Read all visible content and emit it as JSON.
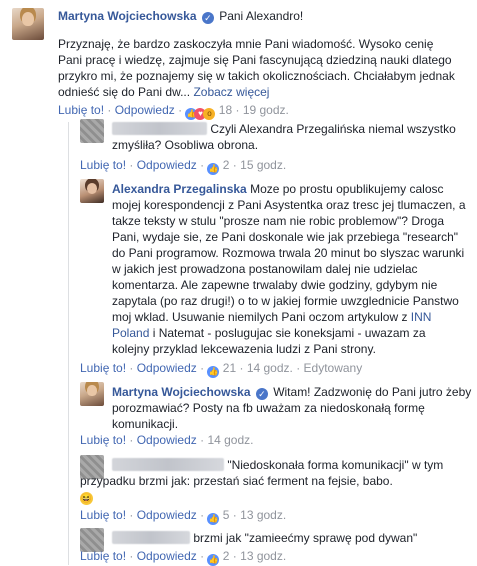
{
  "post": {
    "author": "Martyna Wojciechowska",
    "verified_mark": "✓",
    "title_text": "Pani Alexandro!",
    "line1": "Przyznaję, że bardzo zaskoczyła mnie Pani wiadomość. Wysoko cenię",
    "line2": "Pani pracę i wiedzę, zajmuje się Pani fascynującą dziedziną nauki dlatego",
    "line3": "przykro mi, że poznajemy się w takich okolicznościach. Chciałabym jednak",
    "line4": "odnieść się do Pani dw...",
    "see_more": "Zobacz więcej",
    "like": "Lubię to!",
    "reply": "Odpowiedz",
    "reaction_count": "18",
    "time": "19 godz."
  },
  "comments": [
    {
      "id": "c1",
      "author_hidden": true,
      "line1": "Czyli Alexandra Przegalińska niemal wszystko",
      "line2": "zmyśliła? Osobliwa obrona.",
      "like": "Lubię to!",
      "reply": "Odpowiedz",
      "reaction_count": "2",
      "time": "15 godz."
    },
    {
      "id": "c2",
      "author": "Alexandra Przegalinska",
      "line1": "Moze po prostu opublikujemy calosc",
      "line2": "mojej korespondencji z Pani Asystentka oraz tresc jej tlumaczen, a",
      "line3": "takze teksty w stulu \"prosze nam nie robic problemow\"? Droga",
      "line4": "Pani, wydaje sie, ze Pani doskonale wie jak przebiega \"research\"",
      "line5": "do Pani programow. Rozmowa trwala 20 minut bo slyszac warunki",
      "line6": "w jakich jest prowadzona postanowilam dalej nie udzielac",
      "line7": "komentarza. Ale zapewne trwalaby dwie godziny, gdybym nie",
      "line8": "zapytala (po raz drugi!) o to w jakiej formie uwzglednicie Panstwo",
      "line9": "moj wklad. Usuwanie niemilych Pani oczom artykulow z",
      "link_inn": "INN",
      "link_poland": "Poland",
      "line10": "i Natemat - poslugujac sie koneksjami - uwazam za",
      "line11": "kolejny przyklad lekcewazenia ludzi z Pani strony.",
      "like": "Lubię to!",
      "reply": "Odpowiedz",
      "reaction_count": "21",
      "time": "14 godz.",
      "edited": "Edytowany"
    },
    {
      "id": "c3",
      "author": "Martyna Wojciechowska",
      "line1": "Witam! Zadzwonię do Pani jutro żeby",
      "line2": "porozmawiać? Posty na fb uważam za niedoskonałą formę",
      "line3": "komunikacji.",
      "like": "Lubię to!",
      "reply": "Odpowiedz",
      "time": "14 godz."
    },
    {
      "id": "c4",
      "author_hidden": true,
      "line1": "\"Niedoskonała forma komunikacji\" w tym",
      "line2": "przypadku brzmi jak: przestań siać ferment na fejsie, babo.",
      "emoji": "😆",
      "like": "Lubię to!",
      "reply": "Odpowiedz",
      "reaction_count": "5",
      "time": "13 godz."
    },
    {
      "id": "c5",
      "author_hidden": true,
      "line1": "brzmi jak \"zamieećmy sprawę pod dywan\"",
      "like": "Lubię to!",
      "reply": "Odpowiedz",
      "reaction_count": "2",
      "time": "13 godz."
    }
  ],
  "icons": {
    "like": "like-reaction-icon",
    "love": "love-reaction-icon",
    "wow": "wow-reaction-icon"
  },
  "colors": {
    "name": "#365899",
    "link": "#4267b2",
    "meta": "#90949c",
    "like_blue": "#5890ff"
  }
}
